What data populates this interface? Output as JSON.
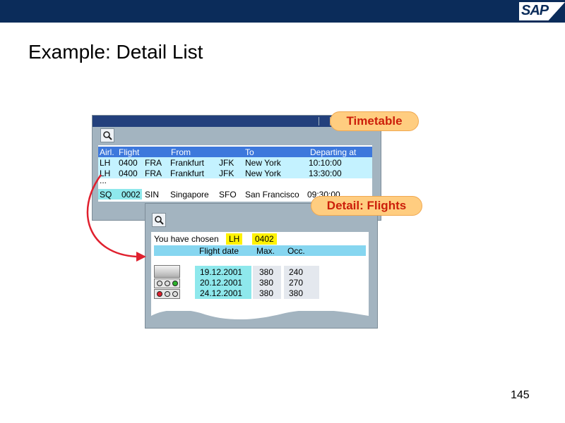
{
  "header": {
    "logo_text": "SAP"
  },
  "title": "Example: Detail List",
  "page_number": "145",
  "callouts": {
    "timetable": "Timetable",
    "detail": "Detail: Flights"
  },
  "timetable": {
    "columns": [
      "Airl.",
      "Flight",
      "From",
      "To",
      "Departing at"
    ],
    "rows": [
      [
        "LH",
        "0400",
        "FRA",
        "Frankfurt",
        "JFK",
        "New York",
        "10:10:00"
      ],
      [
        "LH",
        "0400",
        "FRA",
        "Frankfurt",
        "JFK",
        "New York",
        "13:30:00"
      ],
      [
        "...",
        "",
        "",
        "",
        "",
        "",
        ""
      ],
      [
        "SQ",
        "0002",
        "SIN",
        "Singapore",
        "SFO",
        "San Francisco",
        "09:30:00"
      ]
    ]
  },
  "detail": {
    "chosen_label": "You have chosen",
    "chosen_airline": "LH",
    "chosen_flight": "0402",
    "columns": [
      "Flight date",
      "Max.",
      "Occ."
    ],
    "rows": [
      [
        "19.12.2001",
        "380",
        "240"
      ],
      [
        "20.12.2001",
        "380",
        "270"
      ],
      [
        "24.12.2001",
        "380",
        "380"
      ]
    ]
  },
  "icons": {
    "search": "magnifier-icon",
    "arrow": "curved-arrow-icon",
    "traffic_lights": [
      "traffic-light-green",
      "traffic-light-red"
    ]
  },
  "colors": {
    "topbar": "#0b2c5a",
    "header_row": "#3d78dc",
    "highlight_row": "#c4f2ff",
    "cyan_cells": "#8ee8ec",
    "chosen_highlight": "#fff200",
    "callout_fill": "#ffcd80",
    "callout_text": "#cc1f0a",
    "arrow": "#e0202e"
  }
}
